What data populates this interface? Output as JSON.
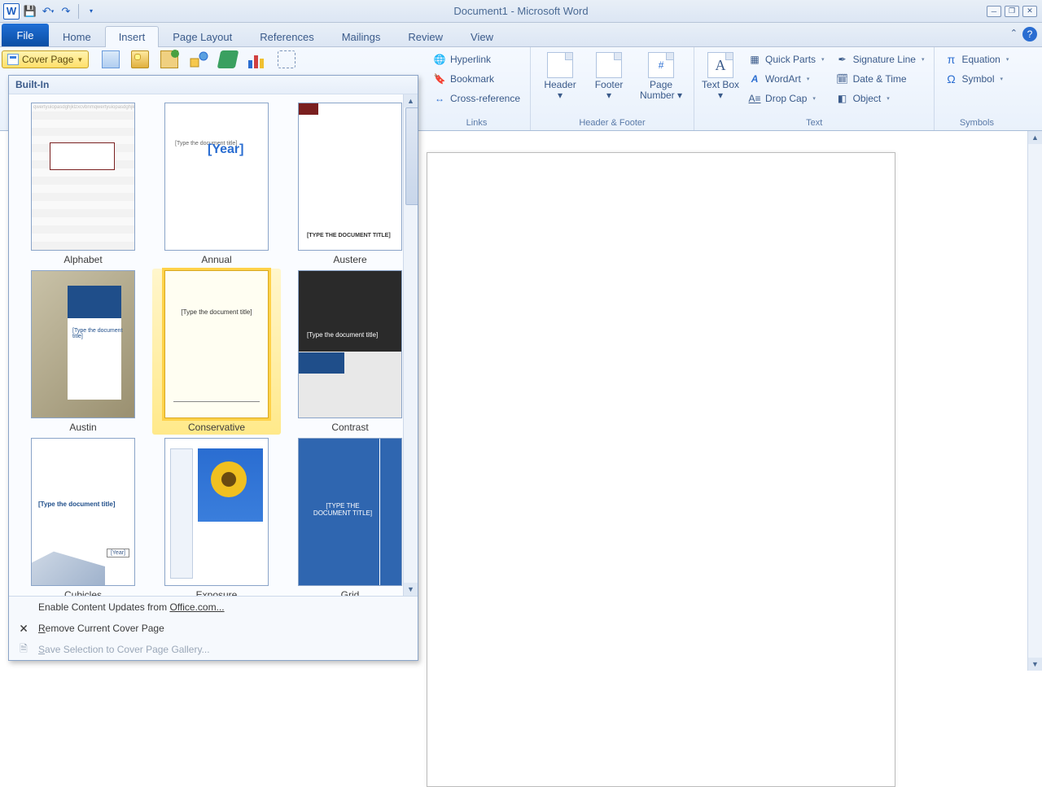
{
  "window": {
    "title": "Document1  -  Microsoft Word"
  },
  "qat": {
    "logo": "W",
    "save_title": "Save",
    "undo_title": "Undo",
    "redo_title": "Redo"
  },
  "tabs": {
    "file": "File",
    "items": [
      "Home",
      "Insert",
      "Page Layout",
      "References",
      "Mailings",
      "Review",
      "View"
    ],
    "active_index": 1
  },
  "ribbon": {
    "cover_page": "Cover Page",
    "links": {
      "group": "Links",
      "hyperlink": "Hyperlink",
      "bookmark": "Bookmark",
      "crossref": "Cross-reference"
    },
    "header_footer": {
      "group": "Header & Footer",
      "header": "Header",
      "footer": "Footer",
      "page_number": "Page Number"
    },
    "text": {
      "group": "Text",
      "text_box": "Text Box",
      "quick_parts": "Quick Parts",
      "wordart": "WordArt",
      "drop_cap": "Drop Cap",
      "signature": "Signature Line",
      "date_time": "Date & Time",
      "object": "Object"
    },
    "symbols": {
      "group": "Symbols",
      "equation": "Equation",
      "symbol": "Symbol"
    }
  },
  "gallery": {
    "header": "Built-In",
    "items": [
      {
        "name": "Alphabet"
      },
      {
        "name": "Annual"
      },
      {
        "name": "Austere"
      },
      {
        "name": "Austin"
      },
      {
        "name": "Conservative"
      },
      {
        "name": "Contrast"
      },
      {
        "name": "Cubicles"
      },
      {
        "name": "Exposure"
      },
      {
        "name": "Grid"
      }
    ],
    "selected_index": 4,
    "thumb_text": {
      "year": "[Year]",
      "type_title": "[Type the document title]",
      "type_title_upper": "[TYPE THE DOCUMENT TITLE]"
    },
    "footer": {
      "enable_updates_pre": "Enable Content Updates from ",
      "enable_updates_link": "Office.com...",
      "remove": "Remove Current Cover Page",
      "save_sel": "Save Selection to Cover Page Gallery..."
    }
  }
}
